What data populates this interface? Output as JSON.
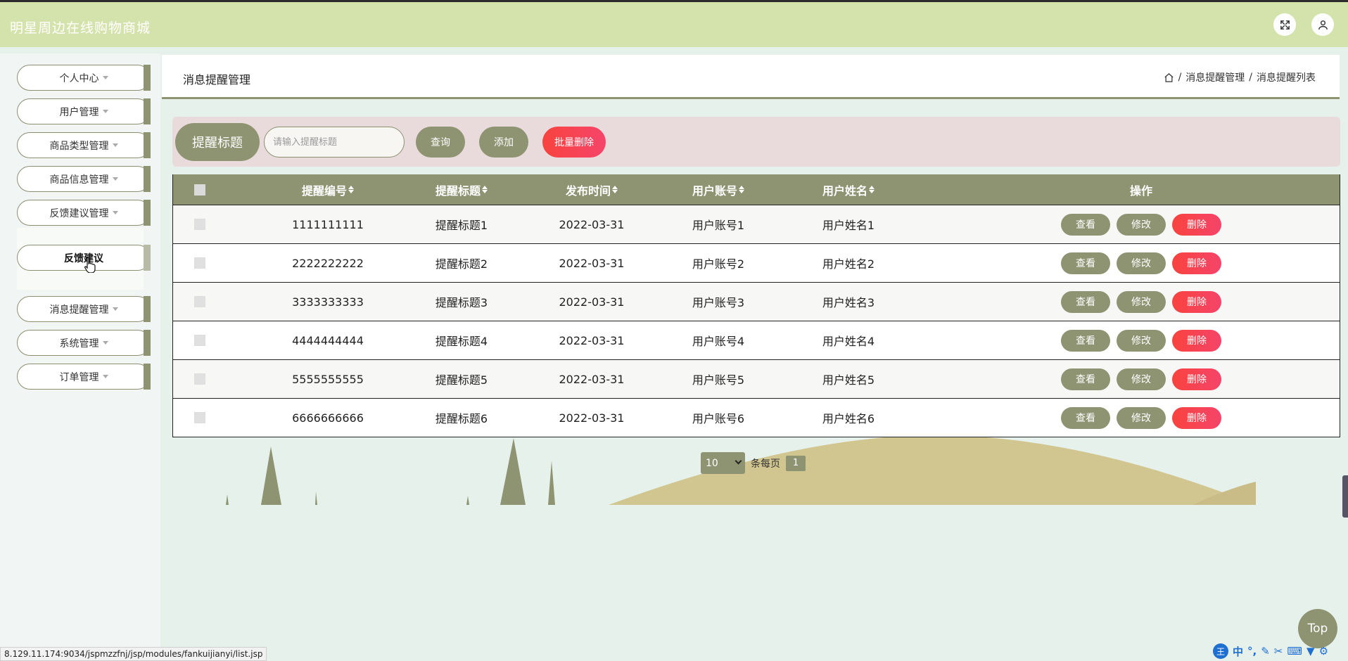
{
  "app": {
    "title": "明星周边在线购物商城"
  },
  "header": {
    "fullscreen_icon": "expand-icon",
    "user_icon": "user-icon"
  },
  "sidebar": {
    "items": [
      {
        "label": "个人中心"
      },
      {
        "label": "用户管理"
      },
      {
        "label": "商品类型管理"
      },
      {
        "label": "商品信息管理"
      },
      {
        "label": "反馈建议管理"
      }
    ],
    "submenu": {
      "label": "反馈建议"
    },
    "items_after": [
      {
        "label": "消息提醒管理"
      },
      {
        "label": "系统管理"
      },
      {
        "label": "订单管理"
      }
    ]
  },
  "page": {
    "title": "消息提醒管理",
    "breadcrumb": [
      "消息提醒管理",
      "消息提醒列表"
    ]
  },
  "search": {
    "label": "提醒标题",
    "placeholder": "请输入提醒标题",
    "query_button": "查询",
    "add_button": "添加",
    "batch_delete_button": "批量删除"
  },
  "table": {
    "columns": [
      "提醒编号",
      "提醒标题",
      "发布时间",
      "用户账号",
      "用户姓名",
      "操作"
    ],
    "rows": [
      {
        "id": "1111111111",
        "title": "提醒标题1",
        "time": "2022-03-31",
        "account": "用户账号1",
        "name": "用户姓名1"
      },
      {
        "id": "2222222222",
        "title": "提醒标题2",
        "time": "2022-03-31",
        "account": "用户账号2",
        "name": "用户姓名2"
      },
      {
        "id": "3333333333",
        "title": "提醒标题3",
        "time": "2022-03-31",
        "account": "用户账号3",
        "name": "用户姓名3"
      },
      {
        "id": "4444444444",
        "title": "提醒标题4",
        "time": "2022-03-31",
        "account": "用户账号4",
        "name": "用户姓名4"
      },
      {
        "id": "5555555555",
        "title": "提醒标题5",
        "time": "2022-03-31",
        "account": "用户账号5",
        "name": "用户姓名5"
      },
      {
        "id": "6666666666",
        "title": "提醒标题6",
        "time": "2022-03-31",
        "account": "用户账号6",
        "name": "用户姓名6"
      }
    ],
    "actions": {
      "view": "查看",
      "edit": "修改",
      "delete": "删除"
    }
  },
  "pagination": {
    "page_size": "10",
    "per_page_label": "条每页",
    "current_page": "1"
  },
  "top_button": "Top",
  "status_url": "8.129.11.174:9034/jspmzzfnj/jsp/modules/fankuijianyi/list.jsp",
  "ime": {
    "lang": "中"
  }
}
